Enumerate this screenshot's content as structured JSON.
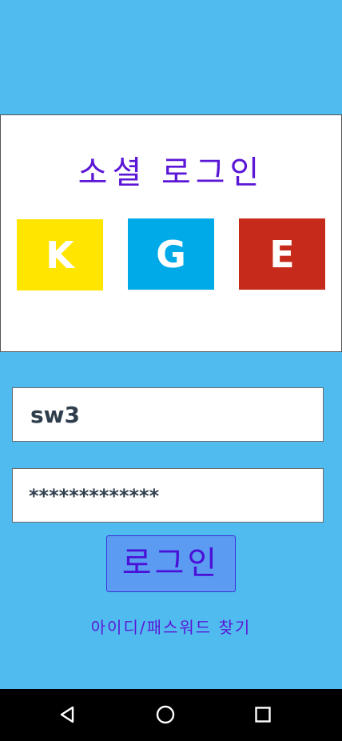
{
  "social": {
    "title": "소셜 로그인",
    "buttons": [
      {
        "label": "K",
        "color": "#FFE500"
      },
      {
        "label": "G",
        "color": "#00AAE8"
      },
      {
        "label": "E",
        "color": "#C62A1A"
      }
    ]
  },
  "login": {
    "id_value": "sw3",
    "password_value": "*************",
    "button_label": "로그인",
    "find_link": "아이디/패스워드 찾기"
  },
  "colors": {
    "background": "#4FBBEF",
    "accent_text": "#5B16D6",
    "login_button": "#5B9CF2"
  },
  "navigation": {
    "icons": [
      "back-icon",
      "home-icon",
      "recent-apps-icon"
    ]
  }
}
